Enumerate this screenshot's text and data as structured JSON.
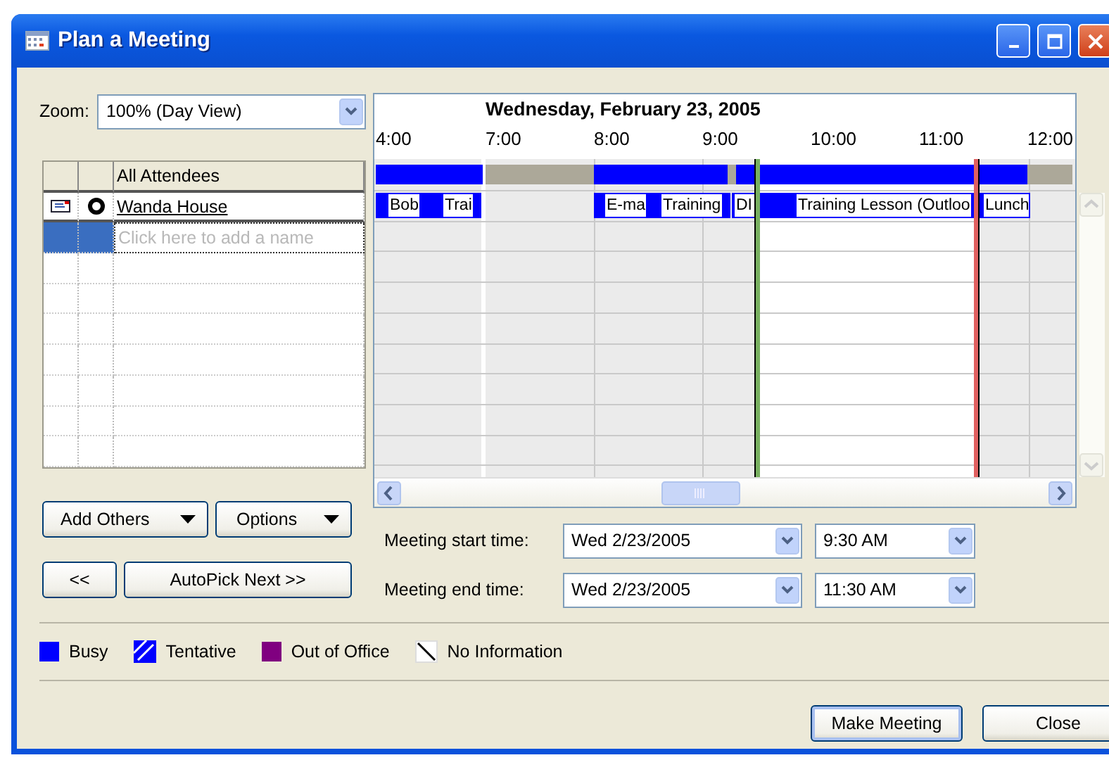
{
  "window": {
    "title": "Plan a Meeting"
  },
  "zoom": {
    "label": "Zoom:",
    "value": "100% (Day View)"
  },
  "attendees": {
    "header": "All Attendees",
    "rows": [
      {
        "name": "Wanda House"
      }
    ],
    "add_placeholder": "Click here to add a name"
  },
  "schedule": {
    "date": "Wednesday, February 23, 2005",
    "hours": [
      "4:00",
      "7:00",
      "8:00",
      "9:00",
      "10:00",
      "11:00",
      "12:00"
    ],
    "events": [
      {
        "label": "Bob"
      },
      {
        "label": "Trai"
      },
      {
        "label": "E-ma"
      },
      {
        "label": "Training"
      },
      {
        "label": "DI"
      },
      {
        "label": "Training Lesson (Outloo"
      },
      {
        "label": "Lunch"
      }
    ]
  },
  "left_buttons": [
    {
      "label": "Add Others",
      "kind": "menu"
    },
    {
      "label": "Options",
      "kind": "menu"
    },
    {
      "label": "<<",
      "kind": "plain"
    },
    {
      "label": "AutoPick Next >>",
      "kind": "plain"
    }
  ],
  "times": [
    {
      "label": "Meeting start time:",
      "date": "Wed 2/23/2005",
      "time": "9:30 AM"
    },
    {
      "label": "Meeting end time:",
      "date": "Wed 2/23/2005",
      "time": "11:30 AM"
    }
  ],
  "legend": [
    {
      "label": "Busy",
      "kind": "solid",
      "color": "#0000ff"
    },
    {
      "label": "Tentative",
      "kind": "hatched",
      "color": "#0000ff"
    },
    {
      "label": "Out of Office",
      "kind": "solid",
      "color": "#800080"
    },
    {
      "label": "No Information",
      "kind": "hatched",
      "color": "#ffffff"
    }
  ],
  "footer_buttons": [
    {
      "label": "Make Meeting",
      "default": true
    },
    {
      "label": "Close",
      "default": false
    }
  ]
}
